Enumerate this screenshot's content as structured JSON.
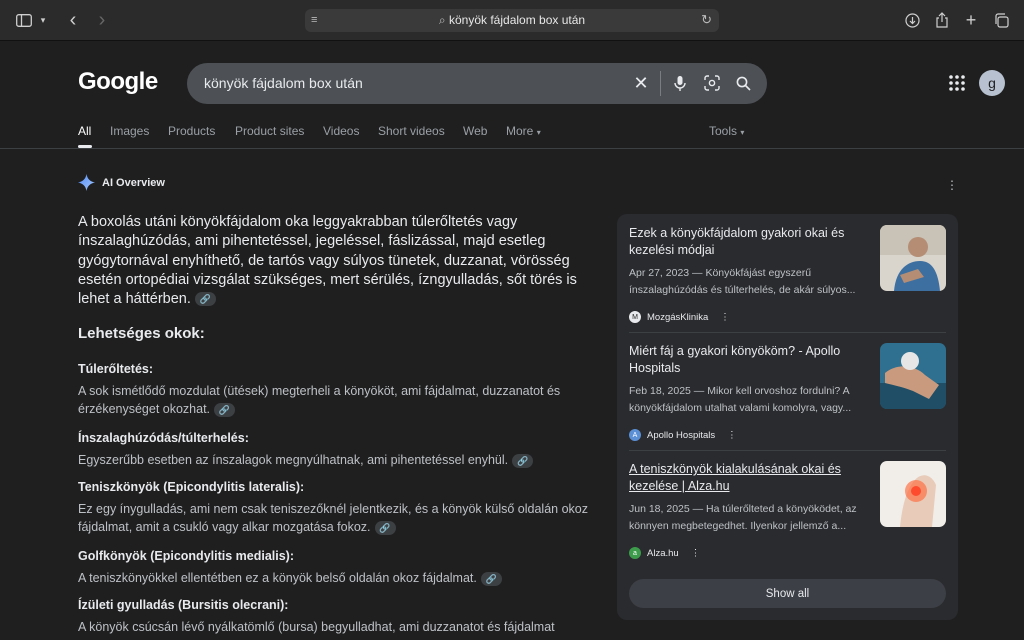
{
  "browser": {
    "url_text": "könyök fájdalom box után",
    "icons": [
      "sidebar-icon",
      "chevron-down-icon",
      "back-icon",
      "forward-icon",
      "page-menu-icon",
      "search-icon",
      "reload-icon",
      "download-icon",
      "share-icon",
      "new-tab-icon",
      "tabs-overview-icon"
    ]
  },
  "google": {
    "logo": "Google",
    "query": "könyök fájdalom box után",
    "avatar_letter": "g",
    "tabs": [
      "All",
      "Images",
      "Products",
      "Product sites",
      "Videos",
      "Short videos",
      "Web",
      "More",
      "Tools"
    ],
    "active_tab": "All"
  },
  "ai_overview": {
    "label": "AI Overview",
    "summary": "A boxolás utáni könyökfájdalom oka leggyakrabban túlerőltetés vagy ínszalaghúzódás, ami pihentetéssel, jegeléssel, fáslizással, majd esetleg gyógytornával enyhíthető, de tartós vagy súlyos tünetek, duzzanat, vörösség esetén ortopédiai vizsgálat szükséges, mert sérülés, ízngyulladás, sőt törés is lehet a háttérben.",
    "causes_heading": "Lehetséges okok:",
    "causes": [
      {
        "title": "Túlerőltetés:",
        "desc": "A sok ismétlődő mozdulat (ütések) megterheli a könyököt, ami fájdalmat, duzzanatot és érzékenységet okozhat."
      },
      {
        "title": "Ínszalaghúzódás/túlterhelés:",
        "desc": "Egyszerűbb esetben az ínszalagok megnyúlhatnak, ami pihentetéssel enyhül."
      },
      {
        "title": "Teniszkönyök (Epicondylitis lateralis):",
        "desc": "Ez egy ínygulladás, ami nem csak teniszezőknél jelentkezik, és a könyök külső oldalán okoz fájdalmat, amit a csukló vagy alkar mozgatása fokoz."
      },
      {
        "title": "Golfkönyök (Epicondylitis medialis):",
        "desc": "A teniszkönyökkel ellentétben ez a könyök belső oldalán okoz fájdalmat."
      },
      {
        "title": "Ízületi gyulladás (Bursitis olecrani):",
        "desc": "A könyök csúcsán lévő nyálkatömlő (bursa) begyulladhat, ami duzzanatot és fájdalmat"
      }
    ],
    "link_chip": "🔗"
  },
  "sources": [
    {
      "title": "Ezek a könyökfájdalom gyakori okai és kezelési módjai",
      "snippet": "Apr 27, 2023 — Könyökfájást egyszerű ínszalaghúzódás és túlterhelés, de akár súlyos...",
      "site": "MozgásKlinika",
      "fav": "M"
    },
    {
      "title": "Miért fáj a gyakori könyököm? - Apollo Hospitals",
      "snippet": "Feb 18, 2025 — Mikor kell orvoshoz fordulni? A könyökfájdalom utalhat valami komolyra, vagy...",
      "site": "Apollo Hospitals",
      "fav": "A"
    },
    {
      "title": "A teniszkönyök kialakulásának okai és kezelése | Alza.hu",
      "snippet": "Jun 18, 2025 — Ha túlerőlteted a könyöködet, az könnyen megbetegedhet. Ilyenkor jellemző a...",
      "site": "Alza.hu",
      "fav": "a"
    }
  ],
  "show_all": "Show all"
}
